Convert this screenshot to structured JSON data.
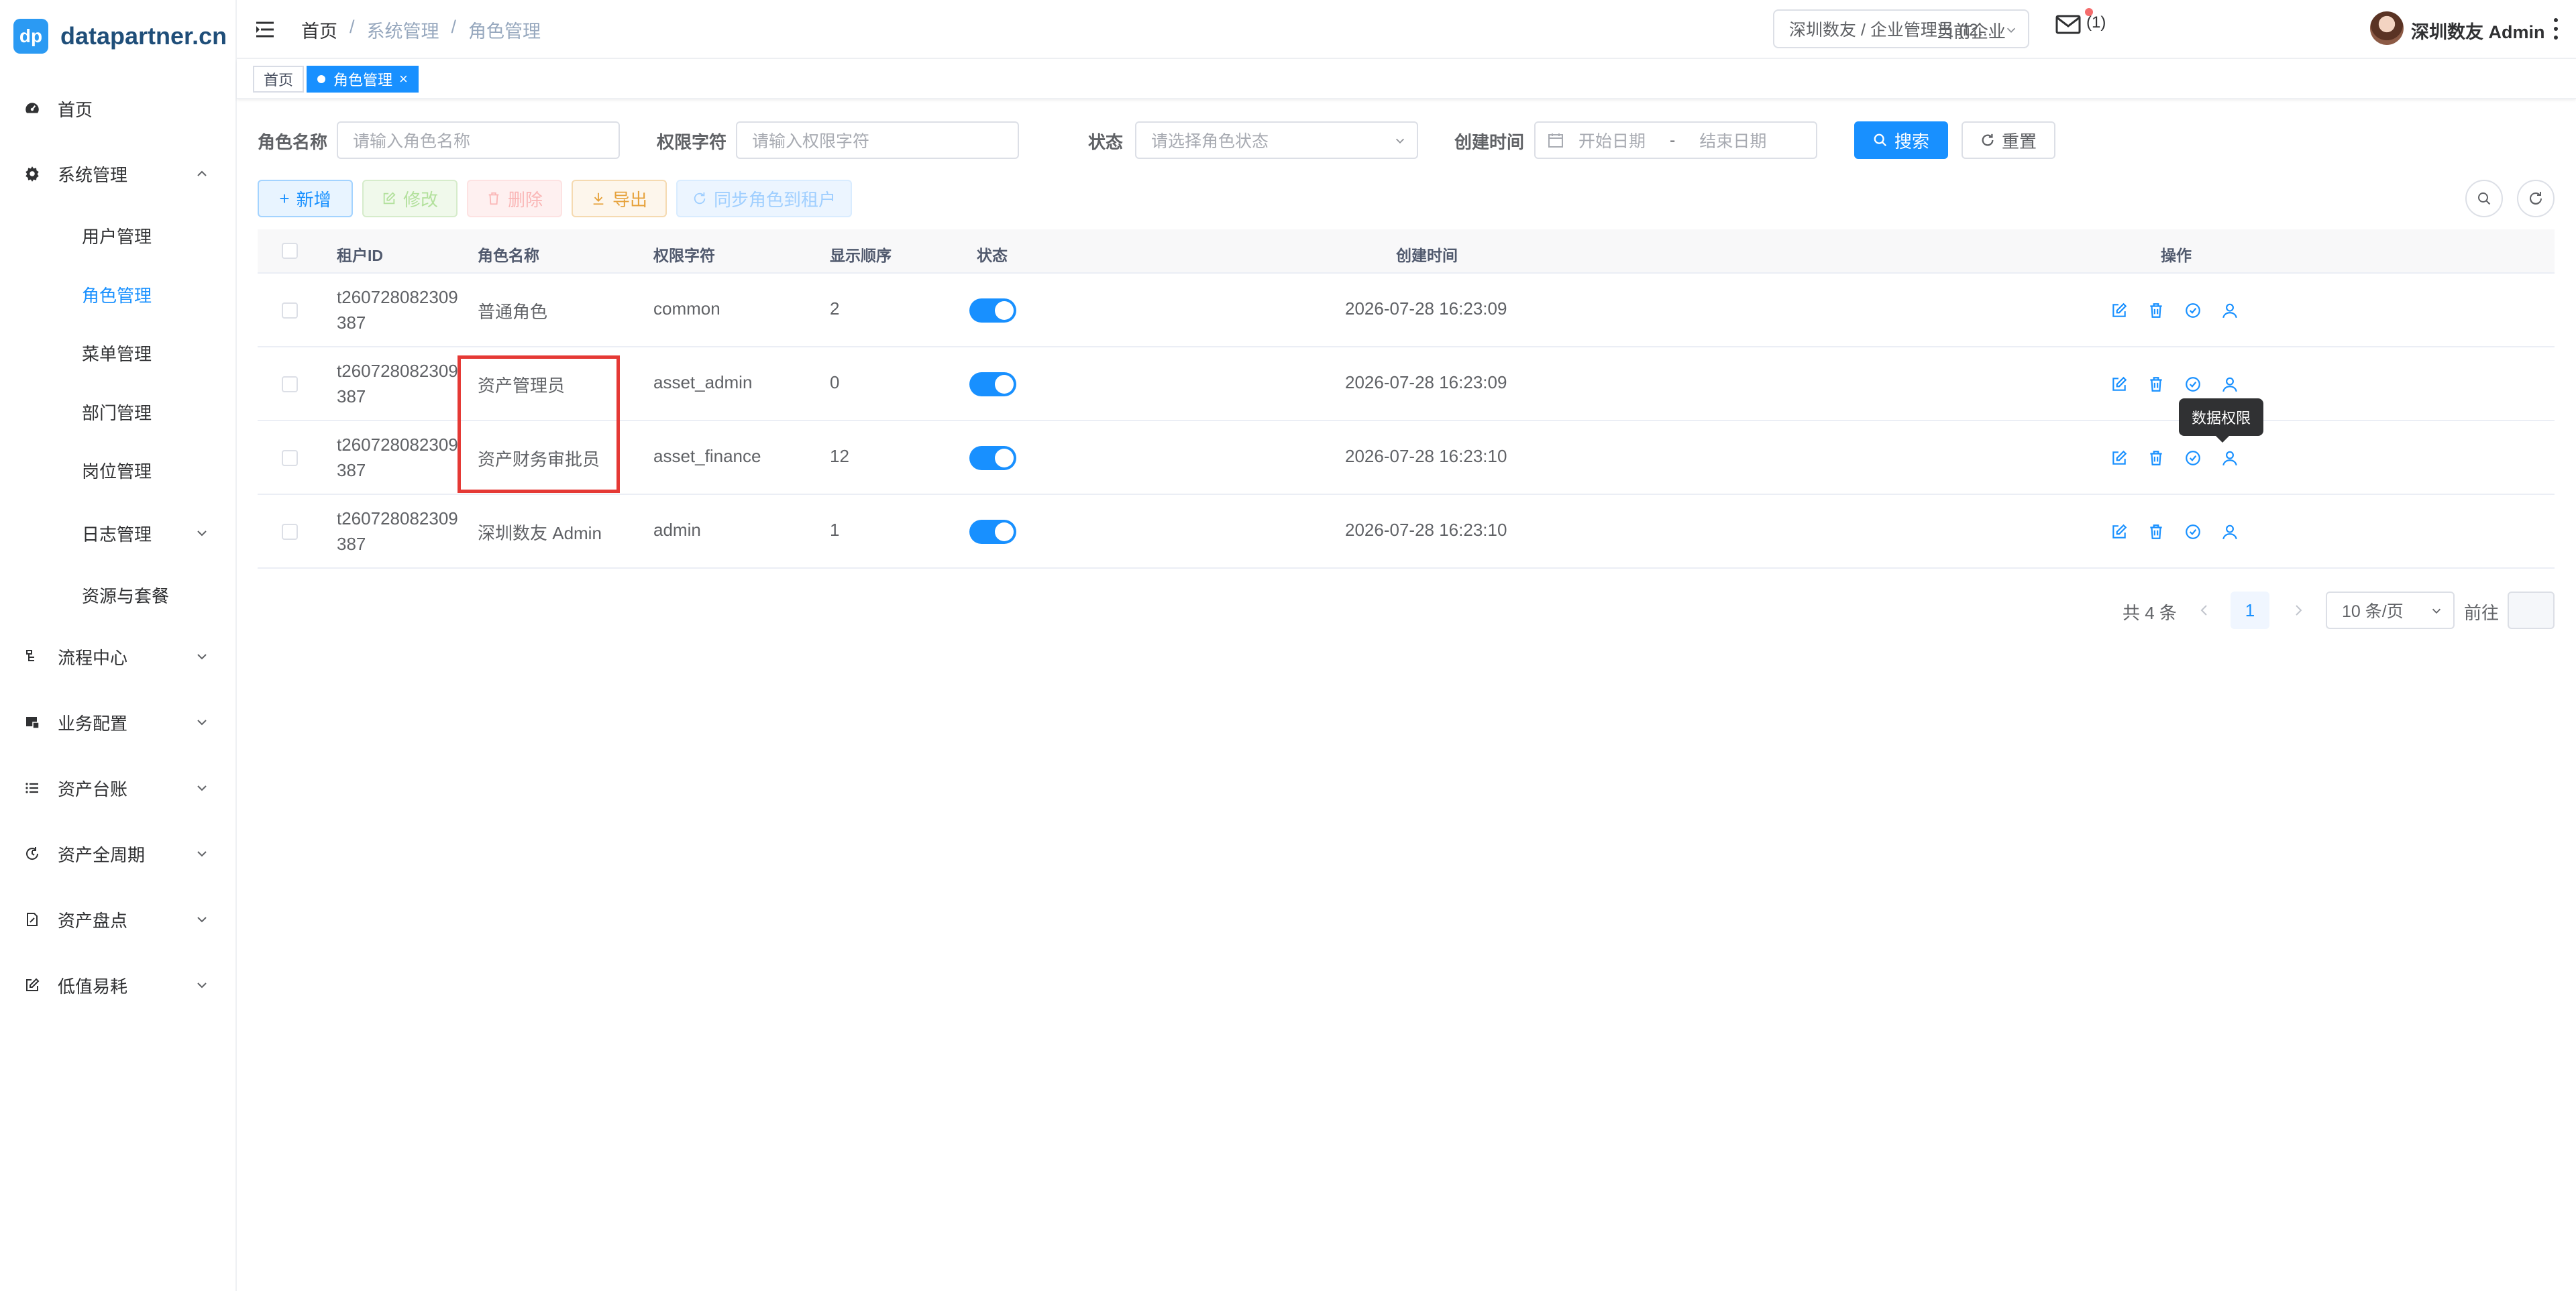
{
  "sidebar": {
    "logo_badge": "dp",
    "logo_text": "datapartner.cn",
    "items": [
      {
        "label": "首页",
        "icon": "dashboard-icon"
      },
      {
        "label": "系统管理",
        "icon": "gear-icon",
        "expanded": true
      },
      {
        "label": "流程中心",
        "icon": "flow-icon"
      },
      {
        "label": "业务配置",
        "icon": "business-config-icon"
      },
      {
        "label": "资产台账",
        "icon": "list-icon"
      },
      {
        "label": "资产全周期",
        "icon": "cycle-icon"
      },
      {
        "label": "资产盘点",
        "icon": "inventory-icon"
      },
      {
        "label": "低值易耗",
        "icon": "edit-square-icon"
      }
    ],
    "subitems": [
      {
        "label": "用户管理"
      },
      {
        "label": "角色管理",
        "active": true
      },
      {
        "label": "菜单管理"
      },
      {
        "label": "部门管理"
      },
      {
        "label": "岗位管理"
      },
      {
        "label": "日志管理"
      },
      {
        "label": "资源与套餐"
      }
    ]
  },
  "header": {
    "breadcrumb": [
      "首页",
      "系统管理",
      "角色管理"
    ],
    "company_label": "当前企业",
    "company_value": "深圳数友 / 企业管理员 (t2...",
    "mail_count": "(1)",
    "user_name": "深圳数友 Admin"
  },
  "tags": [
    {
      "label": "首页"
    },
    {
      "label": "角色管理",
      "close": "×"
    }
  ],
  "search": {
    "role_name_label": "角色名称",
    "role_name_placeholder": "请输入角色名称",
    "perm_label": "权限字符",
    "perm_placeholder": "请输入权限字符",
    "status_label": "状态",
    "status_placeholder": "请选择角色状态",
    "created_label": "创建时间",
    "start_placeholder": "开始日期",
    "range_sep": "-",
    "end_placeholder": "结束日期",
    "search_btn": "搜索",
    "reset_btn": "重置"
  },
  "toolbar": {
    "add": "新增",
    "edit": "修改",
    "delete": "删除",
    "export": "导出",
    "sync": "同步角色到租户"
  },
  "table": {
    "headers": [
      "租户ID",
      "角色名称",
      "权限字符",
      "显示顺序",
      "状态",
      "创建时间",
      "操作"
    ],
    "rows": [
      {
        "tenant": "t260728082309387",
        "name": "普通角色",
        "perm": "common",
        "order": "2",
        "enabled": true,
        "created": "2026-07-28 16:23:09"
      },
      {
        "tenant": "t260728082309387",
        "name": "资产管理员",
        "perm": "asset_admin",
        "order": "0",
        "enabled": true,
        "created": "2026-07-28 16:23:09"
      },
      {
        "tenant": "t260728082309387",
        "name": "资产财务审批员",
        "perm": "asset_finance",
        "order": "12",
        "enabled": true,
        "created": "2026-07-28 16:23:10"
      },
      {
        "tenant": "t260728082309387",
        "name": "深圳数友 Admin",
        "perm": "admin",
        "order": "1",
        "enabled": true,
        "created": "2026-07-28 16:23:10"
      }
    ],
    "tooltip": "数据权限"
  },
  "pagination": {
    "total": "共 4 条",
    "page": "1",
    "size": "10 条/页",
    "goto": "前往"
  },
  "colors": {
    "primary": "#1890ff",
    "highlight": "#e53935"
  }
}
